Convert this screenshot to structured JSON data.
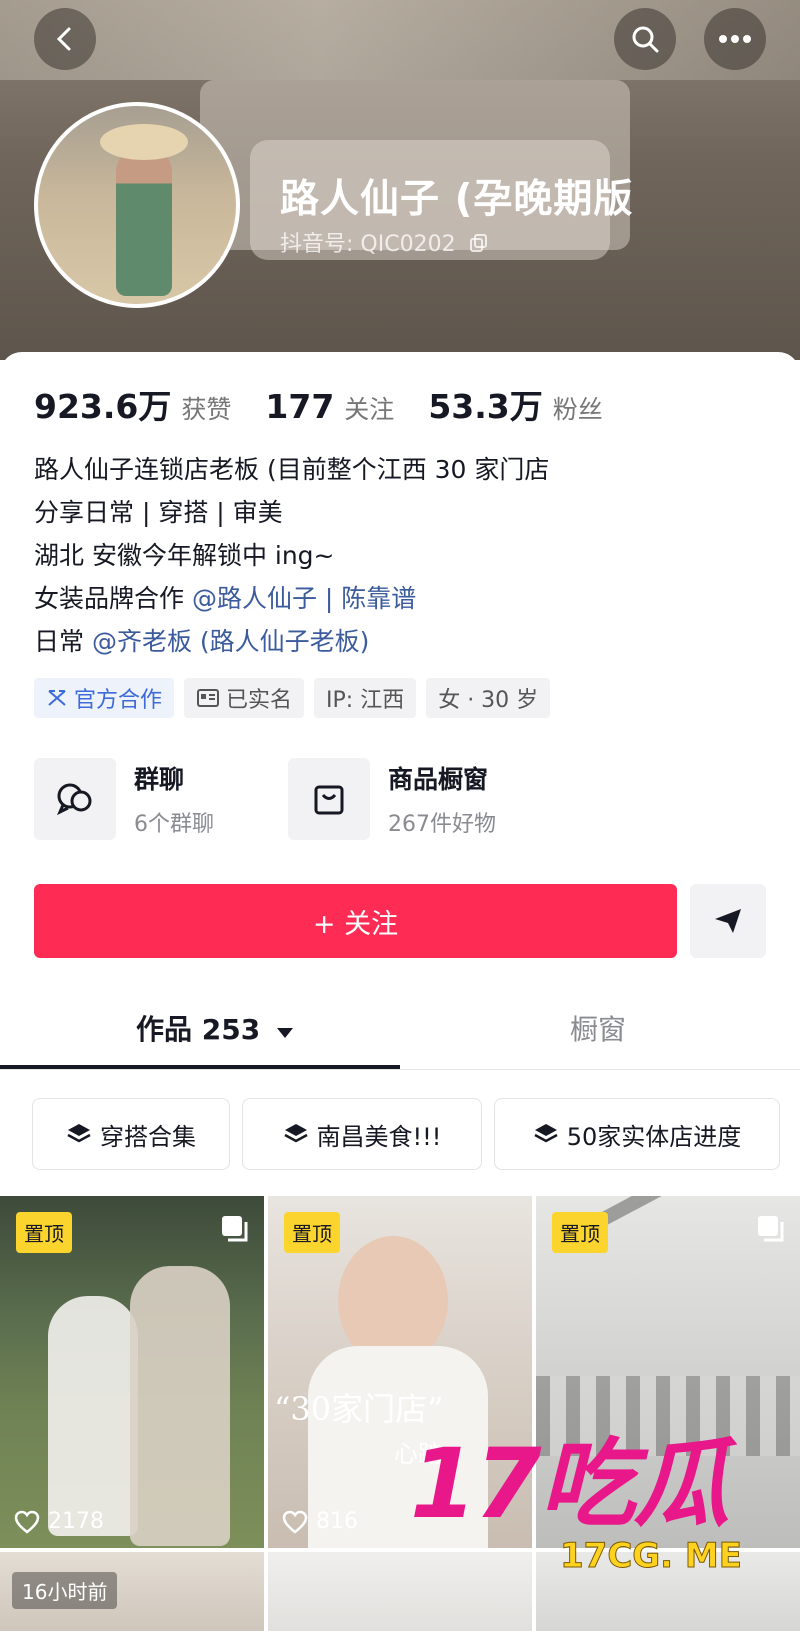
{
  "profile": {
    "name": "路人仙子 (孕晚期版",
    "douyin_id": "抖音号: QIC0202"
  },
  "stats": [
    {
      "value": "923.6万",
      "label": "获赞"
    },
    {
      "value": "177",
      "label": "关注"
    },
    {
      "value": "53.3万",
      "label": "粉丝"
    }
  ],
  "bio": {
    "line1": "路人仙子连锁店老板 (目前整个江西 30 家门店",
    "line2": "分享日常 | 穿搭 | 审美",
    "line3": "湖北 安徽今年解锁中 ing~",
    "line4_prefix": "女装品牌合作 ",
    "line4_link1": "@路人仙子",
    "line4_sep": " | ",
    "line4_link2": "陈靠谱",
    "line5_prefix": "日常 ",
    "line5_link": "@齐老板 (路人仙子老板)"
  },
  "tags": [
    {
      "label": "官方合作",
      "icon": "official-cooperation-icon"
    },
    {
      "label": "已实名",
      "icon": "id-card-icon"
    },
    {
      "label": "IP: 江西"
    },
    {
      "label": "女 · 30 岁"
    }
  ],
  "cards": {
    "group": {
      "title": "群聊",
      "subtitle": "6个群聊",
      "icon": "chat-bubble-icon"
    },
    "shop": {
      "title": "商品橱窗",
      "subtitle": "267件好物",
      "icon": "shopping-bag-icon"
    }
  },
  "actions": {
    "follow": "+ 关注",
    "share_icon": "send-icon"
  },
  "tabs": {
    "works": "作品 253",
    "showcase": "橱窗"
  },
  "collections": [
    "穿搭合集",
    "南昌美食!!!",
    "50家实体店进度"
  ],
  "videos": [
    {
      "pin": "置顶",
      "likes": "2178"
    },
    {
      "pin": "置顶",
      "likes": "816",
      "caption": "“30家门店”",
      "caption2": "心踏"
    },
    {
      "pin": "置顶"
    }
  ],
  "second_row": {
    "time": "16小时前"
  },
  "watermark": {
    "big": "17吃瓜",
    "small": "17CG. ME"
  },
  "colors": {
    "accent": "#fe2c55",
    "link": "#3b5b9c",
    "pin": "#fbd42d"
  }
}
